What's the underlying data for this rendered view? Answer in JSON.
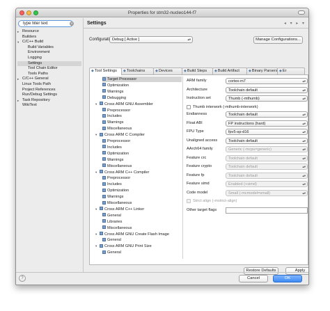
{
  "window": {
    "title": "Properties for stm32-nucleo144-f7"
  },
  "filter": {
    "value": "type filter text"
  },
  "nav": {
    "items": [
      {
        "label": "Resource",
        "indent": 0,
        "twisty": "▸"
      },
      {
        "label": "Builders",
        "indent": 0,
        "twisty": ""
      },
      {
        "label": "C/C++ Build",
        "indent": 0,
        "twisty": "▾"
      },
      {
        "label": "Build Variables",
        "indent": 1,
        "twisty": ""
      },
      {
        "label": "Environment",
        "indent": 1,
        "twisty": ""
      },
      {
        "label": "Logging",
        "indent": 1,
        "twisty": ""
      },
      {
        "label": "Settings",
        "indent": 1,
        "twisty": "",
        "selected": true
      },
      {
        "label": "Tool Chain Editor",
        "indent": 1,
        "twisty": ""
      },
      {
        "label": "Tools Paths",
        "indent": 1,
        "twisty": ""
      },
      {
        "label": "C/C++ General",
        "indent": 0,
        "twisty": "▸"
      },
      {
        "label": "Linux Tools Path",
        "indent": 0,
        "twisty": ""
      },
      {
        "label": "Project References",
        "indent": 0,
        "twisty": ""
      },
      {
        "label": "Run/Debug Settings",
        "indent": 0,
        "twisty": ""
      },
      {
        "label": "Task Repository",
        "indent": 0,
        "twisty": "▸"
      },
      {
        "label": "WikiText",
        "indent": 0,
        "twisty": ""
      }
    ]
  },
  "page": {
    "title": "Settings",
    "nav_arrows": "◂ ▾ ▸ ▾"
  },
  "configuration": {
    "label": "Configuration:",
    "value": "Debug  [ Active ]",
    "manage_label": "Manage Configurations..."
  },
  "tabs": [
    {
      "label": "Tool Settings",
      "active": true
    },
    {
      "label": "Toolchains"
    },
    {
      "label": "Devices"
    },
    {
      "label": "Build Steps"
    },
    {
      "label": "Build Artifact"
    },
    {
      "label": "Binary Parsers"
    },
    {
      "label": "Er"
    }
  ],
  "tool_tree": [
    {
      "label": "Target Processor",
      "level": 1,
      "selected": true
    },
    {
      "label": "Optimization",
      "level": 1
    },
    {
      "label": "Warnings",
      "level": 1
    },
    {
      "label": "Debugging",
      "level": 1
    },
    {
      "label": "Cross ARM GNU Assembler",
      "level": 0,
      "expanded": true
    },
    {
      "label": "Preprocessor",
      "level": 1
    },
    {
      "label": "Includes",
      "level": 1
    },
    {
      "label": "Warnings",
      "level": 1
    },
    {
      "label": "Miscellaneous",
      "level": 1
    },
    {
      "label": "Cross ARM C Compiler",
      "level": 0,
      "expanded": true
    },
    {
      "label": "Preprocessor",
      "level": 1
    },
    {
      "label": "Includes",
      "level": 1
    },
    {
      "label": "Optimization",
      "level": 1
    },
    {
      "label": "Warnings",
      "level": 1
    },
    {
      "label": "Miscellaneous",
      "level": 1
    },
    {
      "label": "Cross ARM C++ Compiler",
      "level": 0,
      "expanded": true
    },
    {
      "label": "Preprocessor",
      "level": 1
    },
    {
      "label": "Includes",
      "level": 1
    },
    {
      "label": "Optimization",
      "level": 1
    },
    {
      "label": "Warnings",
      "level": 1
    },
    {
      "label": "Miscellaneous",
      "level": 1
    },
    {
      "label": "Cross ARM C++ Linker",
      "level": 0,
      "expanded": true
    },
    {
      "label": "General",
      "level": 1
    },
    {
      "label": "Libraries",
      "level": 1
    },
    {
      "label": "Miscellaneous",
      "level": 1
    },
    {
      "label": "Cross ARM GNU Create Flash Image",
      "level": 0,
      "expanded": true
    },
    {
      "label": "General",
      "level": 1
    },
    {
      "label": "Cross ARM GNU Print Size",
      "level": 0,
      "expanded": true
    },
    {
      "label": "General",
      "level": 1
    }
  ],
  "options": [
    {
      "kind": "select",
      "label": "ARM family",
      "value": "cortex-m7"
    },
    {
      "kind": "select",
      "label": "Architecture",
      "value": "Toolchain default"
    },
    {
      "kind": "select",
      "label": "Instruction set",
      "value": "Thumb (-mthumb)"
    },
    {
      "kind": "check",
      "label": "Thumb interwork (-mthumb-interwork)"
    },
    {
      "kind": "select",
      "label": "Endianness",
      "value": "Toolchain default"
    },
    {
      "kind": "select",
      "label": "Float ABI",
      "value": "FP instructions (hard)"
    },
    {
      "kind": "select",
      "label": "FPU Type",
      "value": "fpv5-sp-d16"
    },
    {
      "kind": "select",
      "label": "Unaligned access",
      "value": "Toolchain default"
    },
    {
      "kind": "select",
      "label": "AArch64 family",
      "value": "Generic (-mcpu=generic)",
      "disabled": true
    },
    {
      "kind": "select",
      "label": "Feature crc",
      "value": "Toolchain default",
      "disabled": true
    },
    {
      "kind": "select",
      "label": "Feature crypto",
      "value": "Toolchain default",
      "disabled": true
    },
    {
      "kind": "select",
      "label": "Feature fp",
      "value": "Toolchain default",
      "disabled": true
    },
    {
      "kind": "select",
      "label": "Feature simd",
      "value": "Enabled (+simd)",
      "disabled": true
    },
    {
      "kind": "select",
      "label": "Code model",
      "value": "Small (-mcmodel=small)",
      "disabled": true
    },
    {
      "kind": "check",
      "label": "Strict align (-mstrict-align)",
      "disabled": true
    },
    {
      "kind": "text",
      "label": "Other target flags",
      "value": ""
    }
  ],
  "buttons": {
    "restore": "Restore Defaults",
    "apply": "Apply",
    "cancel": "Cancel",
    "ok": "OK",
    "help": "?"
  },
  "colors": {
    "accent": "#3c8cf3",
    "selection": "#d5d5d5"
  }
}
